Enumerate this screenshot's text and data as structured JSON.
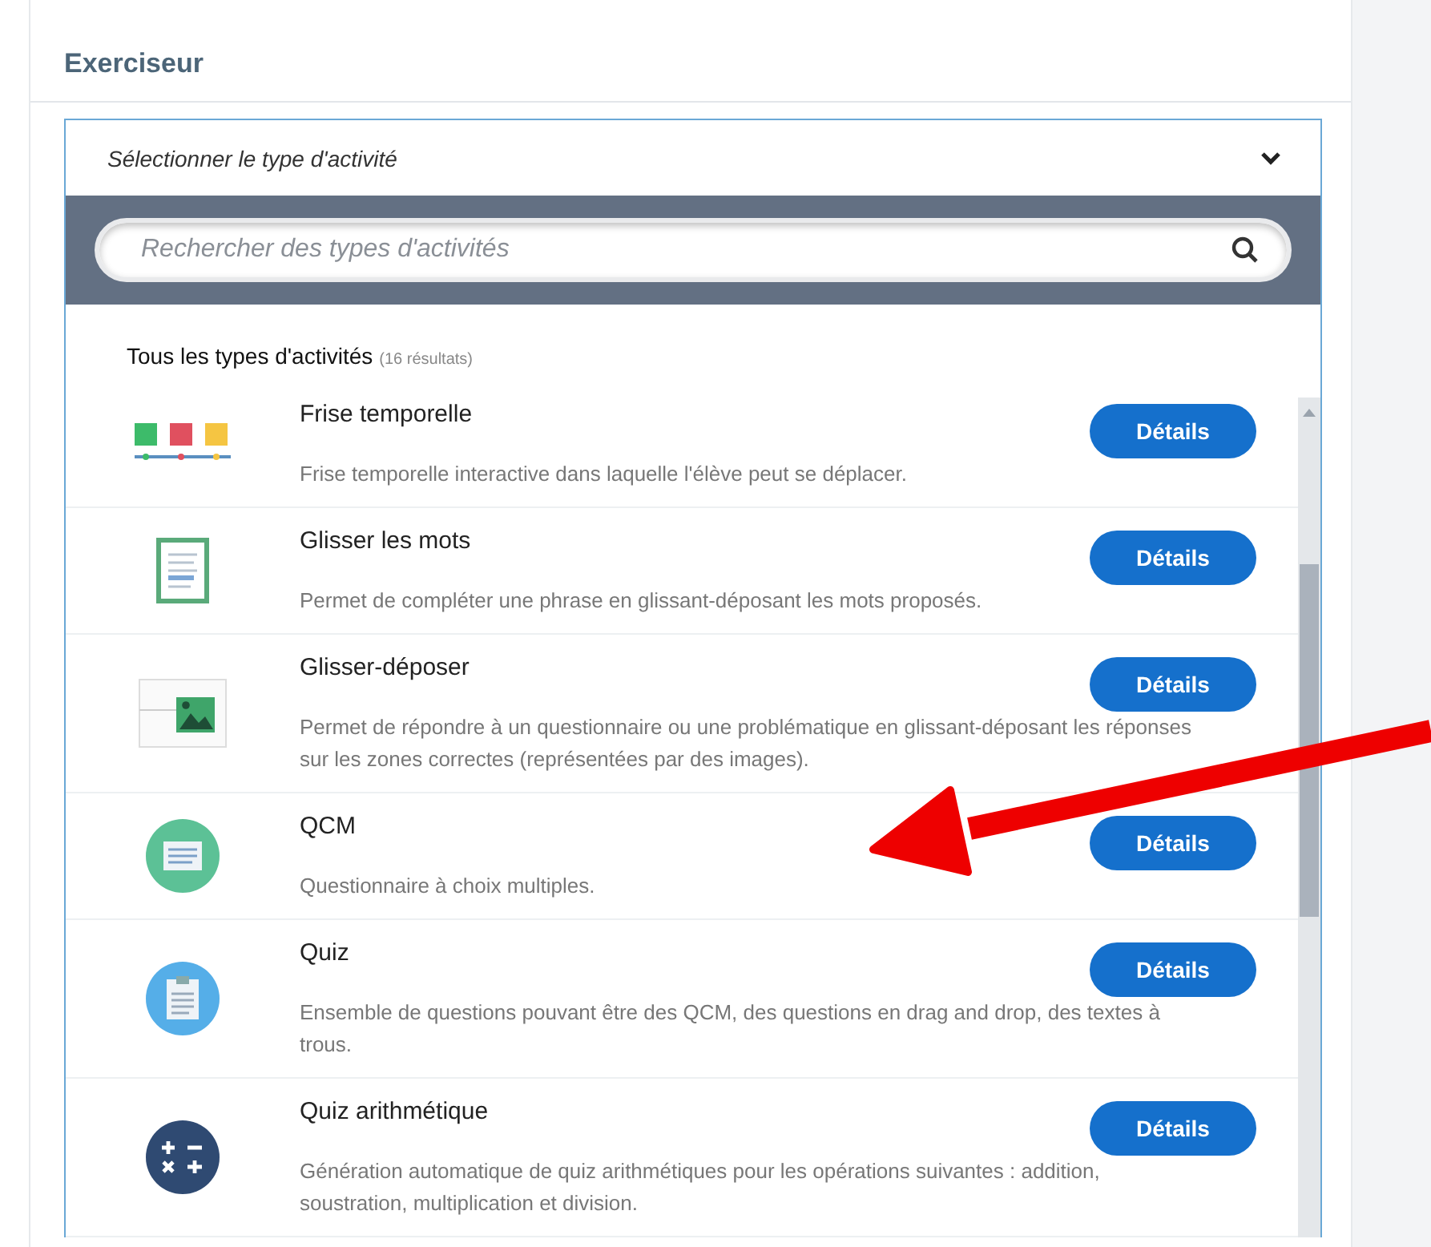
{
  "panel": {
    "title": "Exerciseur"
  },
  "select": {
    "placeholder": "Sélectionner le type d'activité"
  },
  "search": {
    "placeholder": "Rechercher des types d'activités"
  },
  "list_header": {
    "label": "Tous les types d'activités",
    "count": "(16 résultats)"
  },
  "items": [
    {
      "kind": "timeline",
      "title": "Frise temporelle",
      "description": "Frise temporelle interactive dans laquelle l'élève peut se déplacer.",
      "button": "Détails"
    },
    {
      "kind": "text-document",
      "title": "Glisser les mots",
      "description": "Permet de compléter une phrase en glissant-déposant les mots proposés.",
      "button": "Détails"
    },
    {
      "kind": "image-drop",
      "title": "Glisser-déposer",
      "description": "Permet de répondre à un questionnaire ou une problématique en glissant-déposant les réponses sur les zones correctes (représentées par des images).",
      "button": "Détails"
    },
    {
      "kind": "mcq",
      "title": "QCM",
      "description": "Questionnaire à choix multiples.",
      "button": "Détails"
    },
    {
      "kind": "quiz",
      "title": "Quiz",
      "description": "Ensemble de questions pouvant être des QCM, des questions en drag and drop, des textes à trous.",
      "button": "Détails"
    },
    {
      "kind": "math",
      "title": "Quiz arithmétique",
      "description": "Génération automatique de quiz arithmétiques pour les opérations suivantes : addition, soustration, multiplication et division.",
      "button": "Détails"
    }
  ]
}
